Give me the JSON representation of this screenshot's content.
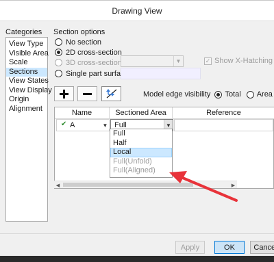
{
  "window": {
    "title": "Drawing View"
  },
  "categories": {
    "label": "Categories",
    "items": [
      "View Type",
      "Visible Area",
      "Scale",
      "Sections",
      "View States",
      "View Display",
      "Origin",
      "Alignment"
    ],
    "selected": "Sections"
  },
  "section_options": {
    "label": "Section options",
    "radios": [
      {
        "label": "No section",
        "checked": false,
        "enabled": true
      },
      {
        "label": "2D cross-section",
        "checked": true,
        "enabled": true
      },
      {
        "label": "3D cross-section",
        "checked": false,
        "enabled": false
      },
      {
        "label": "Single part surface",
        "checked": false,
        "enabled": true
      }
    ],
    "show_xhatching": {
      "label": "Show X-Hatching",
      "checked": true,
      "enabled": false
    }
  },
  "toolbar": {
    "add_icon": "plus-icon",
    "remove_icon": "minus-icon",
    "arrow_icon": "flip-arrow-icon"
  },
  "model_edge_visibility": {
    "label": "Model edge visibility",
    "options": [
      {
        "label": "Total",
        "checked": true
      },
      {
        "label": "Area",
        "checked": false
      }
    ]
  },
  "table": {
    "columns": [
      "Name",
      "Sectioned Area",
      "Reference"
    ],
    "row": {
      "name": "A",
      "sectioned_area": "Full",
      "reference": ""
    }
  },
  "dropdown": {
    "items": [
      {
        "label": "Full",
        "enabled": true,
        "highlighted": false
      },
      {
        "label": "Half",
        "enabled": true,
        "highlighted": false
      },
      {
        "label": "Local",
        "enabled": true,
        "highlighted": true
      },
      {
        "label": "Full(Unfold)",
        "enabled": false,
        "highlighted": false
      },
      {
        "label": "Full(Aligned)",
        "enabled": false,
        "highlighted": false
      }
    ]
  },
  "buttons": {
    "apply": "Apply",
    "ok": "OK",
    "cancel": "Cancel"
  },
  "colors": {
    "selection": "#cce8ff",
    "annotation_arrow": "#e8333a",
    "accent": "#0078d7"
  }
}
